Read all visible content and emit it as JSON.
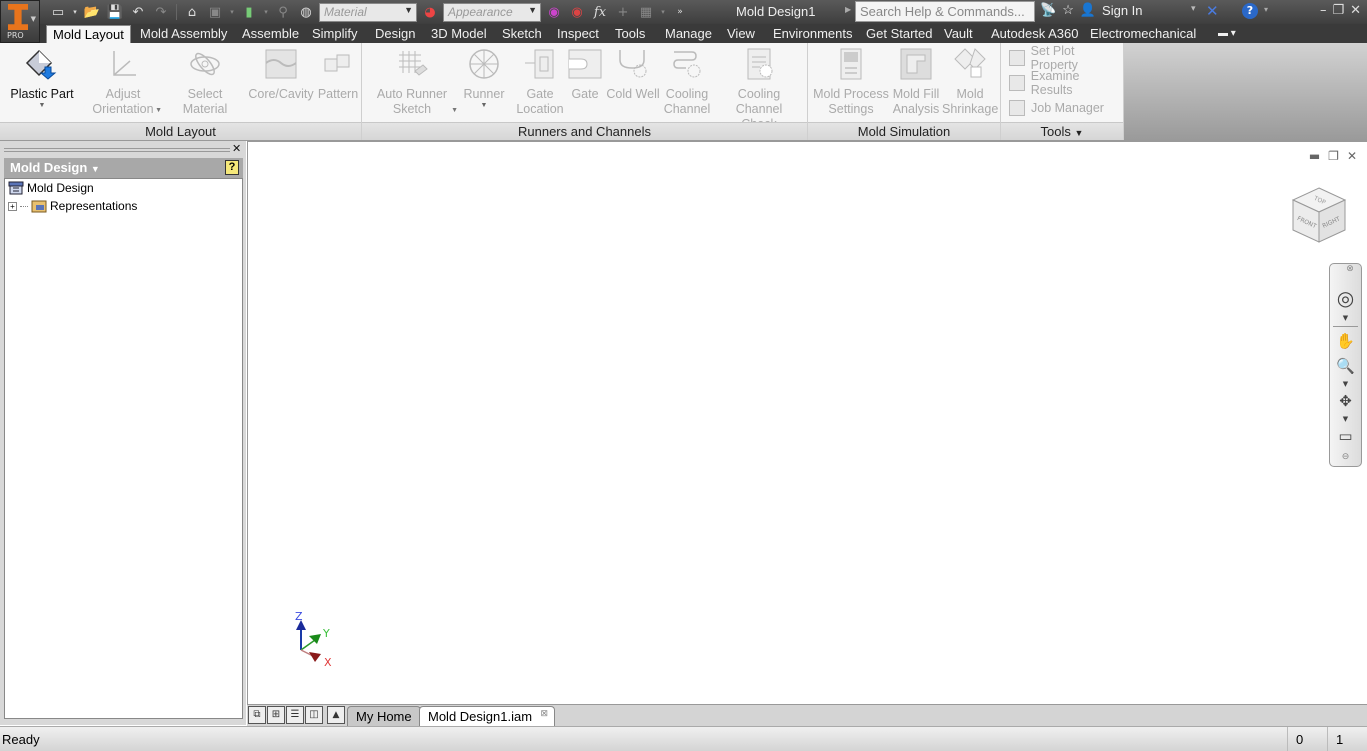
{
  "app": {
    "badge": "PRO",
    "document_title": "Mold Design1"
  },
  "quick_access": {
    "material_placeholder": "Material",
    "appearance_placeholder": "Appearance",
    "icons": [
      "new-icon",
      "open-icon",
      "save-icon",
      "undo-icon",
      "redo-icon",
      "home-icon",
      "update-icon",
      "select-icon",
      "measure-icon",
      "material-icon",
      "appearance-icon",
      "adjust-appearance-icon",
      "clear-appearance-icon",
      "parameters-icon",
      "add-icon",
      "ilogic-icon",
      "more-icon"
    ]
  },
  "search": {
    "placeholder": "Search Help & Commands..."
  },
  "account": {
    "sign_in": "Sign In"
  },
  "ribbon_tabs": [
    {
      "label": "Mold Layout",
      "active": true
    },
    {
      "label": "Mold Assembly"
    },
    {
      "label": "Assemble"
    },
    {
      "label": "Simplify"
    },
    {
      "label": "Design"
    },
    {
      "label": "3D Model"
    },
    {
      "label": "Sketch"
    },
    {
      "label": "Inspect"
    },
    {
      "label": "Tools"
    },
    {
      "label": "Manage"
    },
    {
      "label": "View"
    },
    {
      "label": "Environments"
    },
    {
      "label": "Get Started"
    },
    {
      "label": "Vault"
    },
    {
      "label": "Autodesk A360"
    },
    {
      "label": "Electromechanical"
    }
  ],
  "ribbon": {
    "mold_layout": {
      "title": "Mold Layout",
      "buttons": [
        {
          "label1": "Plastic Part",
          "label2": "",
          "enabled": true
        },
        {
          "label1": "Adjust",
          "label2": "Orientation",
          "enabled": false
        },
        {
          "label1": "Select Material",
          "label2": "",
          "enabled": false
        },
        {
          "label1": "Core/Cavity",
          "label2": "",
          "enabled": false
        },
        {
          "label1": "Pattern",
          "label2": "",
          "enabled": false
        }
      ]
    },
    "runners": {
      "title": "Runners and Channels",
      "buttons": [
        {
          "label1": "Auto Runner",
          "label2": "Sketch"
        },
        {
          "label1": "Runner",
          "label2": ""
        },
        {
          "label1": "Gate",
          "label2": "Location"
        },
        {
          "label1": "Gate",
          "label2": ""
        },
        {
          "label1": "Cold Well",
          "label2": ""
        },
        {
          "label1": "Cooling",
          "label2": "Channel"
        },
        {
          "label1": "Cooling Channel",
          "label2": "Check"
        }
      ]
    },
    "simulation": {
      "title": "Mold Simulation",
      "buttons": [
        {
          "label1": "Mold Process",
          "label2": "Settings"
        },
        {
          "label1": "Mold Fill",
          "label2": "Analysis"
        },
        {
          "label1": "Mold",
          "label2": "Shrinkage"
        }
      ]
    },
    "tools": {
      "title": "Tools",
      "items": [
        "Set Plot Property",
        "Examine Results",
        "Job Manager"
      ]
    }
  },
  "browser": {
    "title": "Mold Design",
    "help": "?",
    "tree": [
      {
        "label": "Mold Design",
        "icon": "assembly-icon"
      },
      {
        "label": "Representations",
        "icon": "representations-folder-icon",
        "expandable": true
      }
    ]
  },
  "viewcube": {
    "faces": [
      "TOP",
      "FRONT",
      "RIGHT"
    ]
  },
  "triad": {
    "x": "X",
    "y": "Y",
    "z": "Z"
  },
  "doc_tabs": [
    {
      "label": "My Home",
      "active": false
    },
    {
      "label": "Mold Design1.iam",
      "active": true
    }
  ],
  "status": {
    "text": "Ready",
    "cell1": "0",
    "cell2": "1"
  }
}
